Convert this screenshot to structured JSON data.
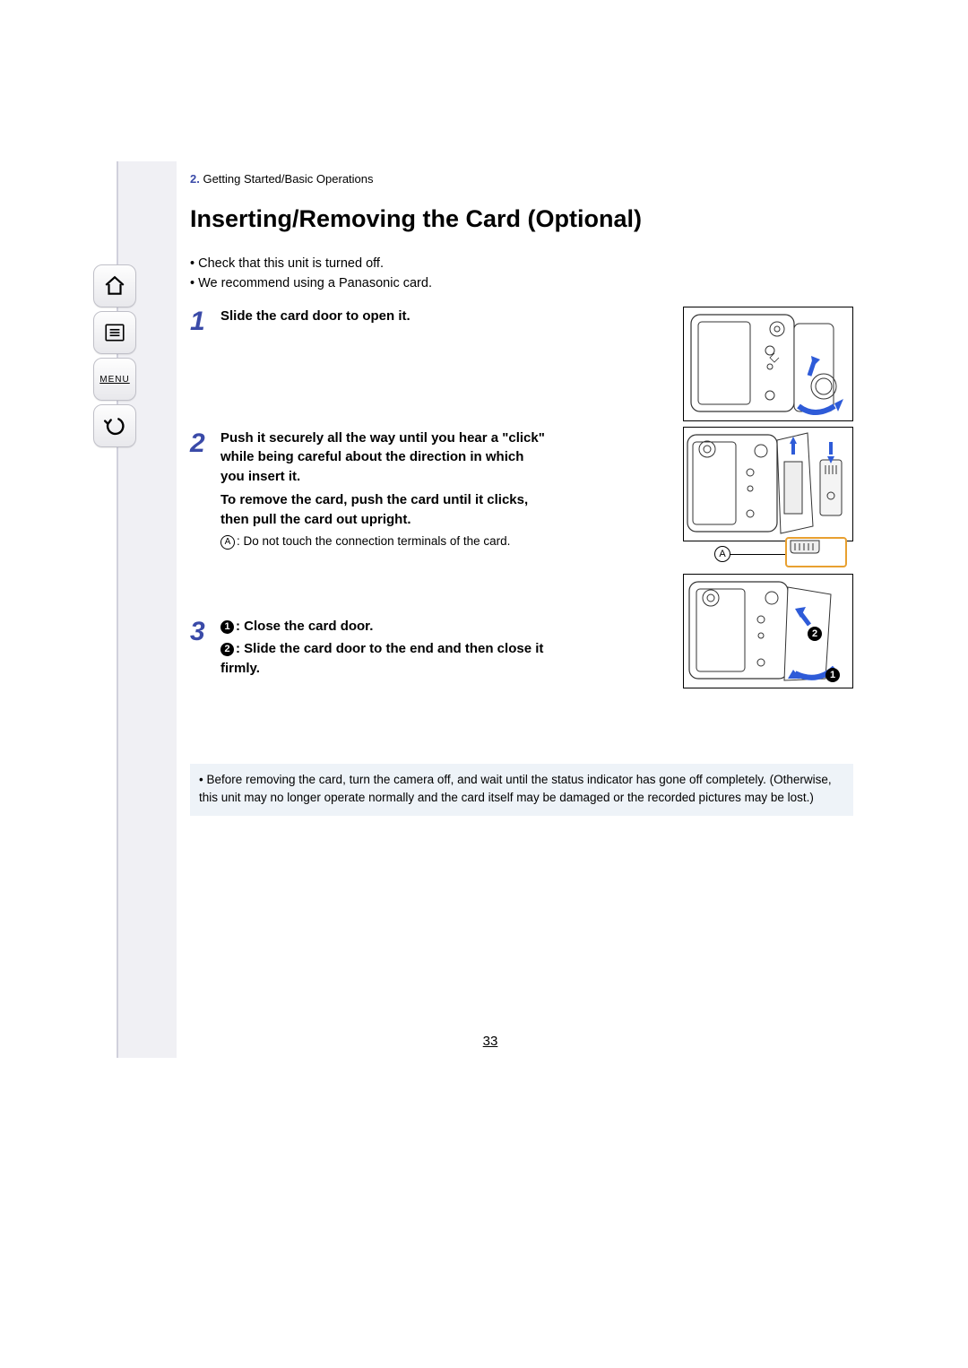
{
  "nav": {
    "menu_label": "MENU"
  },
  "breadcrumb": {
    "num": "2.",
    "text": "Getting Started/Basic Operations"
  },
  "title": "Inserting/Removing the Card (Optional)",
  "intro": [
    "Check that this unit is turned off.",
    "We recommend using a Panasonic card."
  ],
  "steps": [
    {
      "n": "1",
      "main": "Slide the card door to open it."
    },
    {
      "n": "2",
      "main": "Push it securely all the way until you hear a \"click\" while being careful about the direction in which you insert it.",
      "main2": "To remove the card, push the card until it clicks, then pull the card out upright.",
      "note_label": "A",
      "note": ": Do not touch the connection terminals of the card."
    },
    {
      "n": "3",
      "sub1_num": "1",
      "sub1": ": Close the card door.",
      "sub2_num": "2",
      "sub2": ": Slide the card door to the end and then close it firmly."
    }
  ],
  "callout_a": "A",
  "illus3_labels": {
    "one": "1",
    "two": "2"
  },
  "footnote": "Before removing the card, turn the camera off, and wait until the status indicator has gone off completely. (Otherwise, this unit may no longer operate normally and the card itself may be damaged or the recorded pictures may be lost.)",
  "page_number": "33"
}
